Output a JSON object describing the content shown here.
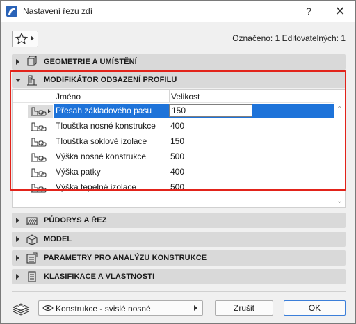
{
  "window": {
    "title": "Nastavení řezu zdí",
    "help_label": "?",
    "close_label": "✕"
  },
  "toolbar": {
    "favorites_icon": "star-icon",
    "selection_info": "Označeno: 1 Editovatelných: 1"
  },
  "panels": {
    "geometry": {
      "label": "GEOMETRIE A UMÍSTĚNÍ",
      "icon": "geometry-icon",
      "expanded": false
    },
    "profile_modifier": {
      "label": "MODIFIKÁTOR ODSAZENÍ PROFILU",
      "icon": "profile-modifier-icon",
      "expanded": true
    },
    "floorplan": {
      "label": "PŮDORYS A ŘEZ",
      "icon": "floorplan-icon",
      "expanded": false
    },
    "model": {
      "label": "MODEL",
      "icon": "model-icon",
      "expanded": false
    },
    "analysis": {
      "label": "PARAMETRY PRO ANALÝZU KONSTRUKCE",
      "icon": "analysis-icon",
      "expanded": false
    },
    "classification": {
      "label": "KLASIFIKACE A VLASTNOSTI",
      "icon": "classification-icon",
      "expanded": false
    }
  },
  "table": {
    "headers": {
      "name": "Jméno",
      "size": "Velikost"
    },
    "rows": [
      {
        "name": "Přesah základového pasu",
        "value": "150",
        "selected": true
      },
      {
        "name": "Tloušťka nosné konstrukce",
        "value": "400",
        "selected": false
      },
      {
        "name": "Tloušťka soklové izolace",
        "value": "150",
        "selected": false
      },
      {
        "name": "Výška nosné konstrukce",
        "value": "500",
        "selected": false
      },
      {
        "name": "Výška patky",
        "value": "400",
        "selected": false
      },
      {
        "name": "Výška tepelné izolace",
        "value": "500",
        "selected": false
      }
    ]
  },
  "footer": {
    "layer_value": "Konstrukce - svislé nosné",
    "cancel_label": "Zrušit",
    "ok_label": "OK"
  },
  "colors": {
    "selection": "#1e73d9",
    "highlight_frame": "#e2231a",
    "panel_header": "#d9d9d9"
  }
}
